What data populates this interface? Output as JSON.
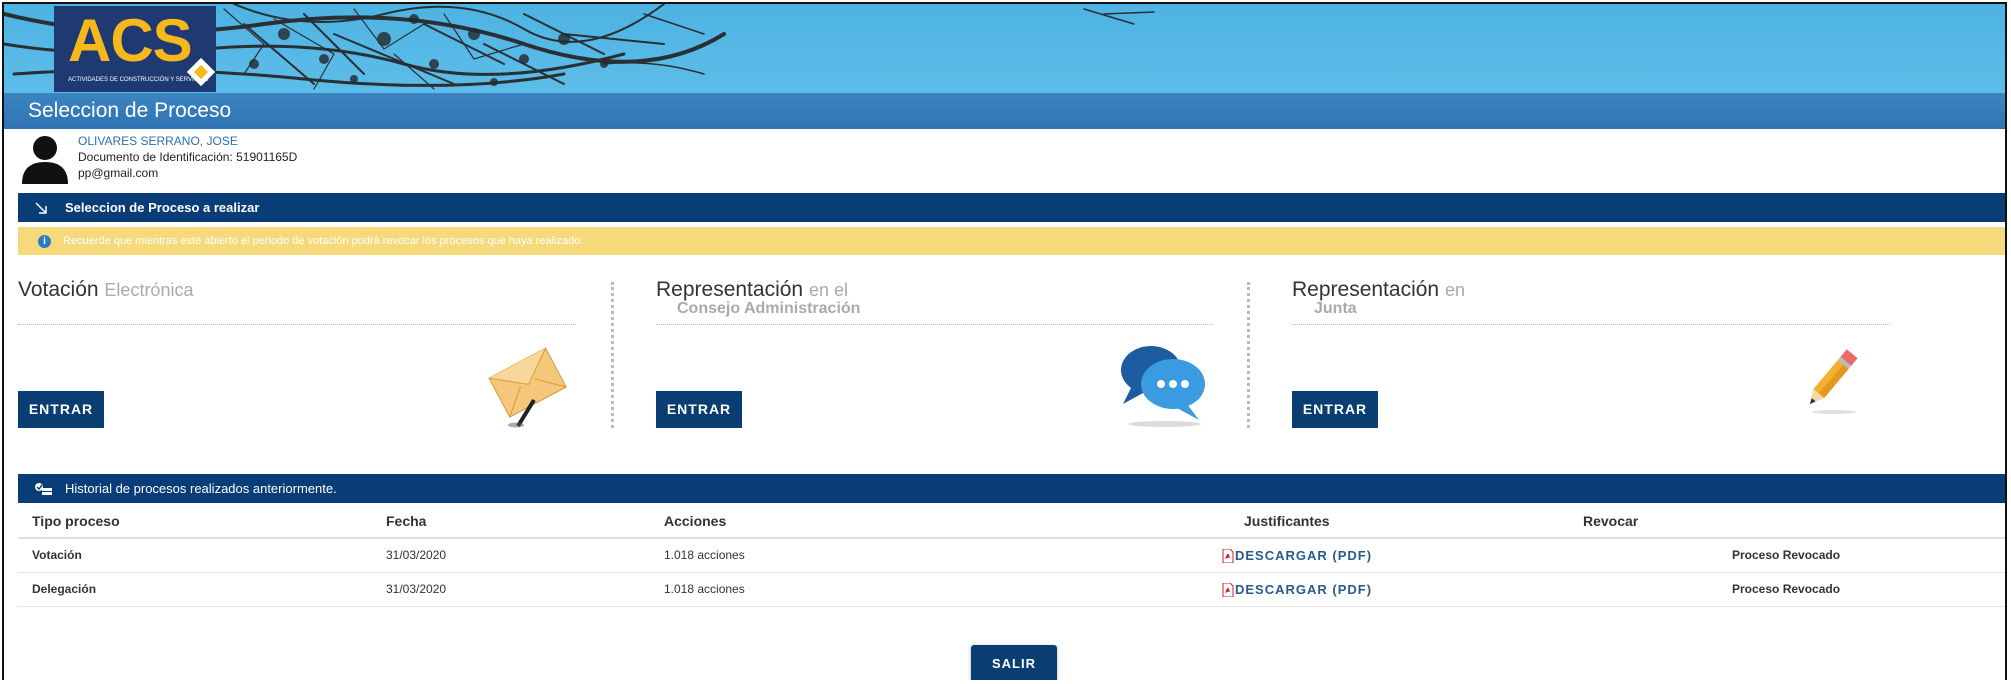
{
  "header": {
    "logo_text": "ACS",
    "logo_subtitle": "ACTIVIDADES DE CONSTRUCCIÓN Y SERVICIOS",
    "page_title": "Seleccion de Proceso"
  },
  "user": {
    "name": "OLIVARES SERRANO, JOSE",
    "document": "Documento de Identificación: 51901165D",
    "email": "pp@gmail.com"
  },
  "process_section": {
    "title": "Seleccion de Proceso a realizar",
    "notice": "Recuerde que mientras esté abierto el periodo de votación podrá revocar los procesos que haya realizado."
  },
  "processes": [
    {
      "title": "Votación",
      "subtitle": "Electrónica",
      "subtitle2": "",
      "button": "ENTRAR",
      "icon": "envelope-icon"
    },
    {
      "title": "Representación",
      "subtitle": "en el",
      "subtitle2": "Consejo Administración",
      "button": "ENTRAR",
      "icon": "chat-bubbles-icon"
    },
    {
      "title": "Representación",
      "subtitle": "en",
      "subtitle2": "Junta",
      "button": "ENTRAR",
      "icon": "pencil-icon"
    }
  ],
  "history": {
    "title": "Historial de procesos realizados anteriormente.",
    "columns": [
      "Tipo proceso",
      "Fecha",
      "Acciones",
      "Justificantes",
      "Revocar"
    ],
    "rows": [
      {
        "tipo": "Votación",
        "fecha": "31/03/2020",
        "acciones": "1.018 acciones",
        "justificante": "DESCARGAR (PDF)",
        "estado": "Proceso Revocado"
      },
      {
        "tipo": "Delegación",
        "fecha": "31/03/2020",
        "acciones": "1.018 acciones",
        "justificante": "DESCARGAR (PDF)",
        "estado": "Proceso Revocado"
      }
    ]
  },
  "footer": {
    "exit_button": "SALIR"
  },
  "colors": {
    "navy": "#083d77",
    "title_blue": "#2f73b3",
    "notice_yellow": "#f5d97a",
    "sky": "#57b9e6",
    "logo_gold": "#f6b81a"
  }
}
